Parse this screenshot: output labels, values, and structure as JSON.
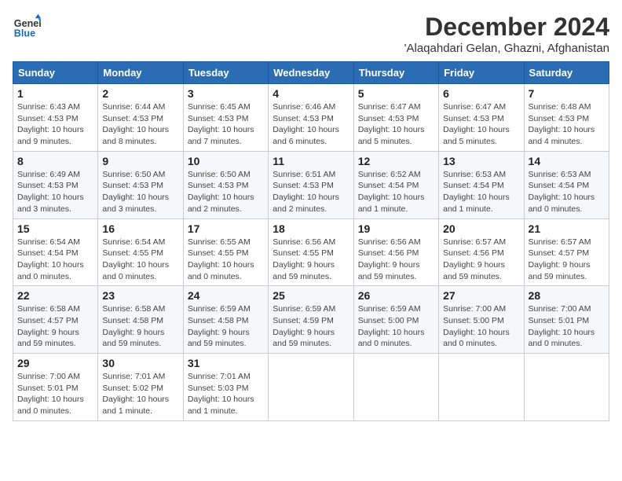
{
  "header": {
    "logo_line1": "General",
    "logo_line2": "Blue",
    "month": "December 2024",
    "location": "'Alaqahdari Gelan, Ghazni, Afghanistan"
  },
  "weekdays": [
    "Sunday",
    "Monday",
    "Tuesday",
    "Wednesday",
    "Thursday",
    "Friday",
    "Saturday"
  ],
  "weeks": [
    [
      {
        "day": "1",
        "sunrise": "6:43 AM",
        "sunset": "4:53 PM",
        "daylight": "10 hours and 9 minutes."
      },
      {
        "day": "2",
        "sunrise": "6:44 AM",
        "sunset": "4:53 PM",
        "daylight": "10 hours and 8 minutes."
      },
      {
        "day": "3",
        "sunrise": "6:45 AM",
        "sunset": "4:53 PM",
        "daylight": "10 hours and 7 minutes."
      },
      {
        "day": "4",
        "sunrise": "6:46 AM",
        "sunset": "4:53 PM",
        "daylight": "10 hours and 6 minutes."
      },
      {
        "day": "5",
        "sunrise": "6:47 AM",
        "sunset": "4:53 PM",
        "daylight": "10 hours and 5 minutes."
      },
      {
        "day": "6",
        "sunrise": "6:47 AM",
        "sunset": "4:53 PM",
        "daylight": "10 hours and 5 minutes."
      },
      {
        "day": "7",
        "sunrise": "6:48 AM",
        "sunset": "4:53 PM",
        "daylight": "10 hours and 4 minutes."
      }
    ],
    [
      {
        "day": "8",
        "sunrise": "6:49 AM",
        "sunset": "4:53 PM",
        "daylight": "10 hours and 3 minutes."
      },
      {
        "day": "9",
        "sunrise": "6:50 AM",
        "sunset": "4:53 PM",
        "daylight": "10 hours and 3 minutes."
      },
      {
        "day": "10",
        "sunrise": "6:50 AM",
        "sunset": "4:53 PM",
        "daylight": "10 hours and 2 minutes."
      },
      {
        "day": "11",
        "sunrise": "6:51 AM",
        "sunset": "4:53 PM",
        "daylight": "10 hours and 2 minutes."
      },
      {
        "day": "12",
        "sunrise": "6:52 AM",
        "sunset": "4:54 PM",
        "daylight": "10 hours and 1 minute."
      },
      {
        "day": "13",
        "sunrise": "6:53 AM",
        "sunset": "4:54 PM",
        "daylight": "10 hours and 1 minute."
      },
      {
        "day": "14",
        "sunrise": "6:53 AM",
        "sunset": "4:54 PM",
        "daylight": "10 hours and 0 minutes."
      }
    ],
    [
      {
        "day": "15",
        "sunrise": "6:54 AM",
        "sunset": "4:54 PM",
        "daylight": "10 hours and 0 minutes."
      },
      {
        "day": "16",
        "sunrise": "6:54 AM",
        "sunset": "4:55 PM",
        "daylight": "10 hours and 0 minutes."
      },
      {
        "day": "17",
        "sunrise": "6:55 AM",
        "sunset": "4:55 PM",
        "daylight": "10 hours and 0 minutes."
      },
      {
        "day": "18",
        "sunrise": "6:56 AM",
        "sunset": "4:55 PM",
        "daylight": "9 hours and 59 minutes."
      },
      {
        "day": "19",
        "sunrise": "6:56 AM",
        "sunset": "4:56 PM",
        "daylight": "9 hours and 59 minutes."
      },
      {
        "day": "20",
        "sunrise": "6:57 AM",
        "sunset": "4:56 PM",
        "daylight": "9 hours and 59 minutes."
      },
      {
        "day": "21",
        "sunrise": "6:57 AM",
        "sunset": "4:57 PM",
        "daylight": "9 hours and 59 minutes."
      }
    ],
    [
      {
        "day": "22",
        "sunrise": "6:58 AM",
        "sunset": "4:57 PM",
        "daylight": "9 hours and 59 minutes."
      },
      {
        "day": "23",
        "sunrise": "6:58 AM",
        "sunset": "4:58 PM",
        "daylight": "9 hours and 59 minutes."
      },
      {
        "day": "24",
        "sunrise": "6:59 AM",
        "sunset": "4:58 PM",
        "daylight": "9 hours and 59 minutes."
      },
      {
        "day": "25",
        "sunrise": "6:59 AM",
        "sunset": "4:59 PM",
        "daylight": "9 hours and 59 minutes."
      },
      {
        "day": "26",
        "sunrise": "6:59 AM",
        "sunset": "5:00 PM",
        "daylight": "10 hours and 0 minutes."
      },
      {
        "day": "27",
        "sunrise": "7:00 AM",
        "sunset": "5:00 PM",
        "daylight": "10 hours and 0 minutes."
      },
      {
        "day": "28",
        "sunrise": "7:00 AM",
        "sunset": "5:01 PM",
        "daylight": "10 hours and 0 minutes."
      }
    ],
    [
      {
        "day": "29",
        "sunrise": "7:00 AM",
        "sunset": "5:01 PM",
        "daylight": "10 hours and 0 minutes."
      },
      {
        "day": "30",
        "sunrise": "7:01 AM",
        "sunset": "5:02 PM",
        "daylight": "10 hours and 1 minute."
      },
      {
        "day": "31",
        "sunrise": "7:01 AM",
        "sunset": "5:03 PM",
        "daylight": "10 hours and 1 minute."
      },
      null,
      null,
      null,
      null
    ]
  ]
}
